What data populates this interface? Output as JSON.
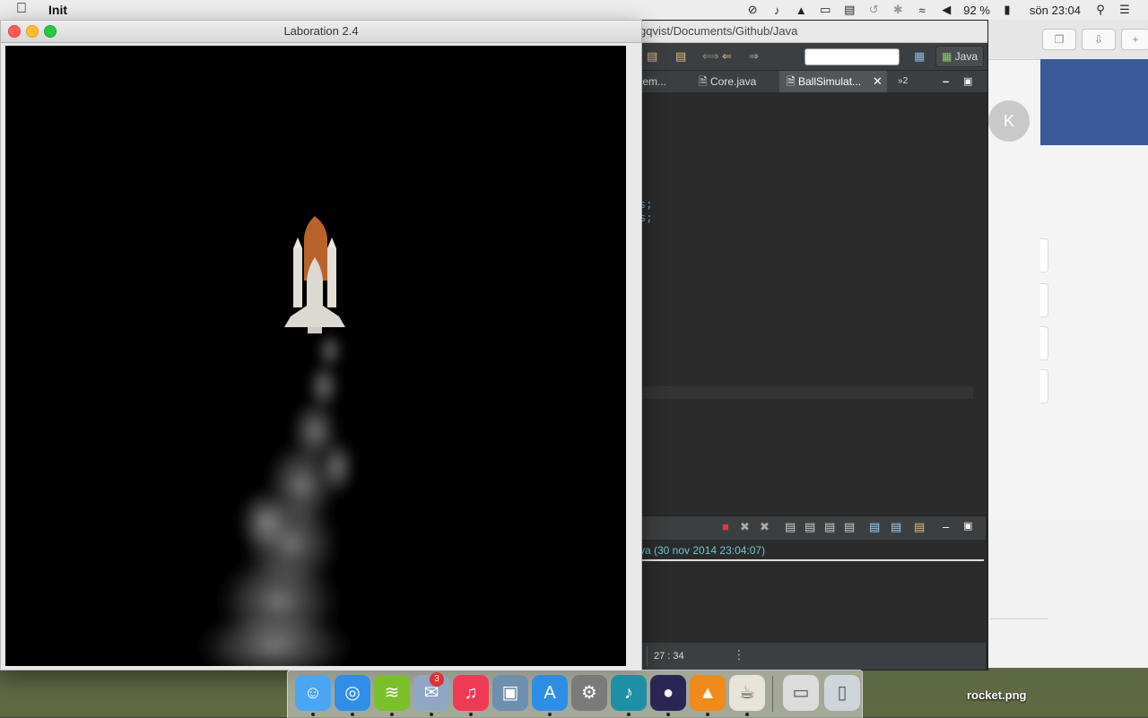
{
  "menubar": {
    "app_name": "Init",
    "battery_percent": "92 %",
    "clock": "sön 23:04",
    "icons": [
      "apple-icon",
      "sync-icon",
      "music-note-icon",
      "google-drive-icon",
      "airplay-icon",
      "memory-icon",
      "time-machine-icon",
      "bluetooth-icon",
      "wifi-icon",
      "volume-icon",
      "battery-icon",
      "spotlight-icon",
      "notification-center-icon"
    ]
  },
  "laboration_window": {
    "title": "Laboration 2.4",
    "scene": {
      "background": "#000000",
      "rocket_body": "#dcd8d2",
      "rocket_tank": "#b8632c",
      "smoke": "#d8d8d8"
    }
  },
  "eclipse": {
    "title_path": "gqvist/Documents/Github/Java",
    "perspective": "Java",
    "tabs": [
      {
        "label": "tem...",
        "active": false
      },
      {
        "label": "Core.java",
        "active": false
      },
      {
        "label": "BallSimulat...",
        "active": true
      }
    ],
    "overflow_count": "2",
    "code_fragments": [
      "s;",
      "s;"
    ],
    "console_launch": "va (30 nov 2014 23:04:07)",
    "cursor_position": "27 : 34"
  },
  "browser": {
    "avatar_letter": "K",
    "fb_color": "#3b5998"
  },
  "dock": {
    "items": [
      {
        "name": "Finder",
        "icon": "finder-icon",
        "color": "#4aa6f2"
      },
      {
        "name": "Safari",
        "icon": "safari-icon",
        "color": "#2f8ee8"
      },
      {
        "name": "Spotify",
        "icon": "spotify-icon",
        "color": "#7bbf2a"
      },
      {
        "name": "Mail",
        "icon": "mail-icon",
        "color": "#8fa7c4",
        "badge": "3"
      },
      {
        "name": "iTunes",
        "icon": "itunes-icon",
        "color": "#ef3a55"
      },
      {
        "name": "iPhoto",
        "icon": "iphoto-icon",
        "color": "#6f8fae"
      },
      {
        "name": "App Store",
        "icon": "app-store-icon",
        "color": "#2e8ee6"
      },
      {
        "name": "System Preferences",
        "icon": "system-preferences-icon",
        "color": "#7a7a7a"
      },
      {
        "name": "iTunes Helper",
        "icon": "music-helper-icon",
        "color": "#1f8fa6"
      },
      {
        "name": "Eclipse",
        "icon": "eclipse-icon",
        "color": "#2b2553"
      },
      {
        "name": "VLC",
        "icon": "vlc-icon",
        "color": "#ef8a1d"
      },
      {
        "name": "Java",
        "icon": "java-icon",
        "color": "#e8e4da"
      },
      {
        "name": "Downloads",
        "icon": "downloads-stack-icon",
        "color": "#dcdcdc"
      },
      {
        "name": "Trash",
        "icon": "trash-icon",
        "color": "#cfd6db"
      }
    ]
  },
  "desktop": {
    "file_label": "rocket.png"
  }
}
